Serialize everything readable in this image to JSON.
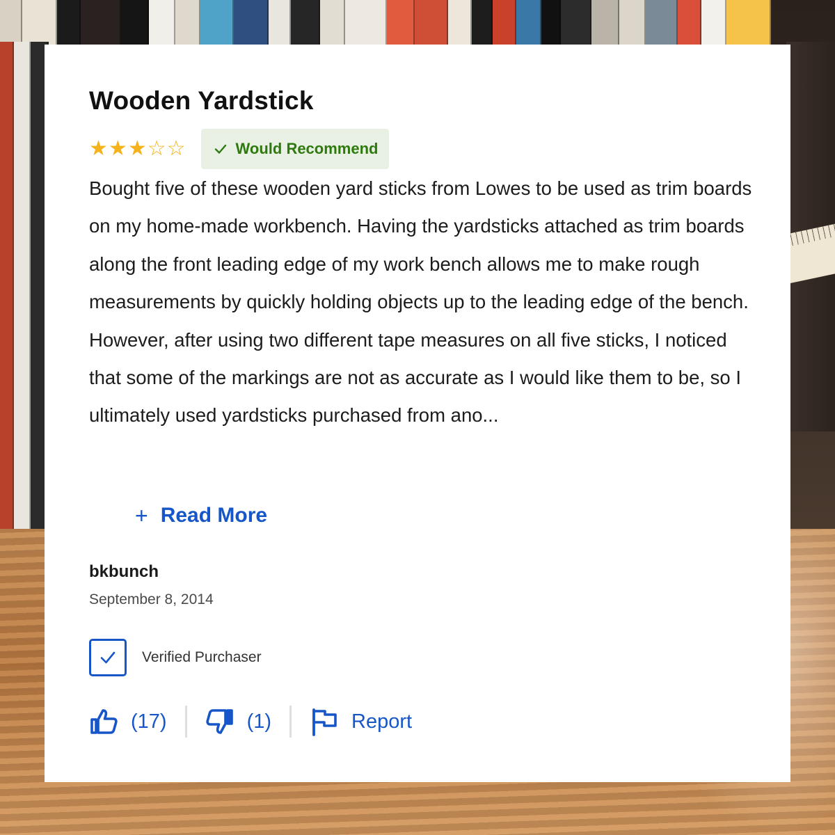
{
  "review": {
    "title": "Wooden Yardstick",
    "rating": 3,
    "rating_max": 5,
    "recommend_label": "Would Recommend",
    "body": "Bought five of these wooden yard sticks from Lowes to be used as trim boards on my home-made workbench. Having the yardsticks attached as trim boards along the front leading edge of my work bench allows me to make rough measurements by quickly holding objects up to the leading edge of the bench. However, after using two different tape measures on all five sticks, I noticed that some of the markings are not as accurate as I would like them to be, so I ultimately used yardsticks purchased from ano...",
    "read_more_label": "Read More",
    "author": "bkbunch",
    "date": "September 8, 2014",
    "verified_label": "Verified Purchaser",
    "helpful_count": "(17)",
    "unhelpful_count": "(1)",
    "report_label": "Report"
  },
  "icons": {
    "stars": "star-icon",
    "recommend": "check-icon",
    "read_more": "plus-icon",
    "verified": "checkbox-checked-icon",
    "helpful": "thumbs-up-icon",
    "unhelpful": "thumbs-down-icon",
    "report": "flag-icon"
  },
  "colors": {
    "star": "#f5b21b",
    "recommend_text": "#2f7a0f",
    "recommend_bg": "#e8f1e4",
    "link": "#1656c8",
    "title": "#111111"
  }
}
